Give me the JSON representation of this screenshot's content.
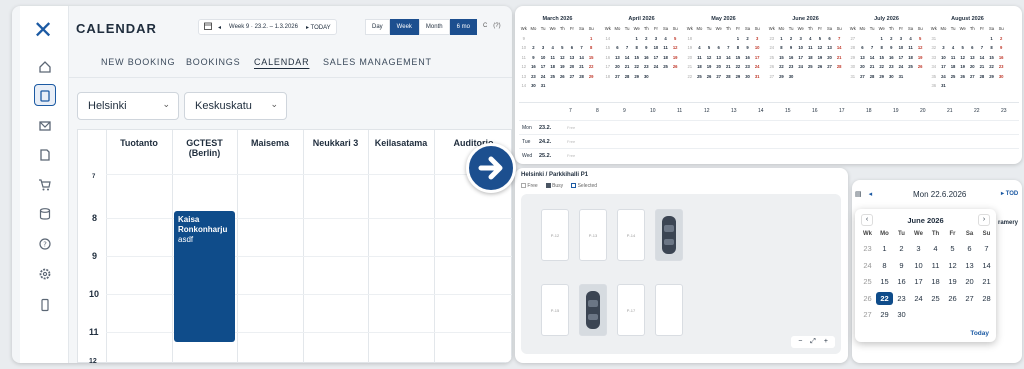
{
  "app": {
    "title": "CALENDAR",
    "date_range": "Week 9 · 23.2. – 1.3.2026",
    "today_label": "TODAY",
    "prev_label": "◂",
    "next_label": "▸",
    "help_label": "(?)",
    "refresh_label": "C",
    "views": [
      "Day",
      "Week",
      "Month",
      "6 mo"
    ],
    "tabs": [
      "NEW BOOKING",
      "BOOKINGS",
      "CALENDAR",
      "SALES MANAGEMENT"
    ],
    "city_select": "Helsinki",
    "street_select": "Keskuskatu",
    "columns": [
      "Tuotanto",
      "GCTEST\n(Berlin)",
      "Maisema",
      "Neukkari 3",
      "Keilasatama",
      "Auditorio"
    ],
    "hours": [
      "7",
      "8",
      "9",
      "10",
      "11",
      "12"
    ],
    "booking": {
      "name": "Kaisa Ronkonharju",
      "note": "asdf"
    },
    "colors": {
      "accent": "#0f4c8a",
      "brand": "#1c5aa3"
    },
    "sidebar_icons": [
      "home-icon",
      "document-icon",
      "mail-icon",
      "file-icon",
      "cart-icon",
      "database-icon",
      "help-icon",
      "settings-icon",
      "phone-icon"
    ]
  },
  "mini": {
    "months": [
      {
        "name": "March 2026",
        "weeks": [
          [
            "9",
            "",
            "",
            "",
            "",
            "",
            "",
            "1"
          ],
          [
            "10",
            "2",
            "3",
            "4",
            "5",
            "6",
            "7",
            "8"
          ],
          [
            "11",
            "9",
            "10",
            "11",
            "12",
            "13",
            "14",
            "15"
          ],
          [
            "12",
            "16",
            "17",
            "18",
            "19",
            "20",
            "21",
            "22"
          ],
          [
            "13",
            "23",
            "24",
            "25",
            "26",
            "27",
            "28",
            "29"
          ],
          [
            "14",
            "30",
            "31",
            "",
            "",
            "",
            "",
            ""
          ]
        ]
      },
      {
        "name": "April 2026",
        "weeks": [
          [
            "14",
            "",
            "",
            "1",
            "2",
            "3",
            "4",
            "5"
          ],
          [
            "15",
            "6",
            "7",
            "8",
            "9",
            "10",
            "11",
            "12"
          ],
          [
            "16",
            "13",
            "14",
            "15",
            "16",
            "17",
            "18",
            "19"
          ],
          [
            "17",
            "20",
            "21",
            "22",
            "23",
            "24",
            "25",
            "26"
          ],
          [
            "18",
            "27",
            "28",
            "29",
            "30",
            "",
            "",
            ""
          ]
        ]
      },
      {
        "name": "May 2026",
        "weeks": [
          [
            "18",
            "",
            "",
            "",
            "",
            "1",
            "2",
            "3"
          ],
          [
            "19",
            "4",
            "5",
            "6",
            "7",
            "8",
            "9",
            "10"
          ],
          [
            "20",
            "11",
            "12",
            "13",
            "14",
            "15",
            "16",
            "17"
          ],
          [
            "21",
            "18",
            "19",
            "20",
            "21",
            "22",
            "23",
            "24"
          ],
          [
            "22",
            "25",
            "26",
            "27",
            "28",
            "29",
            "30",
            "31"
          ]
        ]
      },
      {
        "name": "June 2026",
        "weeks": [
          [
            "23",
            "1",
            "2",
            "3",
            "4",
            "5",
            "6",
            "7"
          ],
          [
            "24",
            "8",
            "9",
            "10",
            "11",
            "12",
            "13",
            "14"
          ],
          [
            "25",
            "15",
            "16",
            "17",
            "18",
            "19",
            "20",
            "21"
          ],
          [
            "26",
            "22",
            "23",
            "24",
            "25",
            "26",
            "27",
            "28"
          ],
          [
            "27",
            "29",
            "30",
            "",
            "",
            "",
            "",
            ""
          ]
        ]
      },
      {
        "name": "July 2026",
        "weeks": [
          [
            "27",
            "",
            "",
            "1",
            "2",
            "3",
            "4",
            "5"
          ],
          [
            "28",
            "6",
            "7",
            "8",
            "9",
            "10",
            "11",
            "12"
          ],
          [
            "29",
            "13",
            "14",
            "15",
            "16",
            "17",
            "18",
            "19"
          ],
          [
            "30",
            "20",
            "21",
            "22",
            "23",
            "24",
            "25",
            "26"
          ],
          [
            "31",
            "27",
            "28",
            "29",
            "30",
            "31",
            "",
            ""
          ]
        ]
      },
      {
        "name": "August 2026",
        "weeks": [
          [
            "31",
            "",
            "",
            "",
            "",
            "",
            "1",
            "2"
          ],
          [
            "32",
            "3",
            "4",
            "5",
            "6",
            "7",
            "8",
            "9"
          ],
          [
            "33",
            "10",
            "11",
            "12",
            "13",
            "14",
            "15",
            "16"
          ],
          [
            "34",
            "17",
            "18",
            "19",
            "20",
            "21",
            "22",
            "23"
          ],
          [
            "35",
            "24",
            "25",
            "26",
            "27",
            "28",
            "29",
            "30"
          ],
          [
            "36",
            "31",
            "",
            "",
            "",
            "",
            "",
            ""
          ]
        ]
      }
    ],
    "weekday_header": [
      "Wk",
      "Mo",
      "Tu",
      "We",
      "Th",
      "Fr",
      "Sa",
      "Su"
    ],
    "timeline_hours": [
      "7",
      "8",
      "9",
      "10",
      "11",
      "12",
      "13",
      "14",
      "15",
      "16",
      "17",
      "18",
      "19",
      "20",
      "21",
      "22",
      "23"
    ],
    "timeline_rows": [
      {
        "day": "Mon",
        "date": "23.2.",
        "tag": "Free"
      },
      {
        "day": "Tue",
        "date": "24.2.",
        "tag": "Free"
      },
      {
        "day": "Wed",
        "date": "25.2.",
        "tag": "Free"
      }
    ]
  },
  "parking": {
    "title": "Helsinki / Parkkihalli P1",
    "legend": [
      "Free",
      "Busy",
      "Selected"
    ],
    "spots_top": [
      "P-12",
      "P-13",
      "P-14"
    ],
    "spots_bottom": [
      "P-15",
      "P-17"
    ],
    "zoom_controls": [
      "−",
      "⤢",
      "+"
    ]
  },
  "picker": {
    "header_date": "Mon 22.6.2026",
    "today_short": "TOD",
    "side_text": "ramery",
    "month": "June 2026",
    "days_header": [
      "Wk",
      "Mo",
      "Tu",
      "We",
      "Th",
      "Fr",
      "Sa",
      "Su"
    ],
    "weeks": [
      [
        "23",
        "1",
        "2",
        "3",
        "4",
        "5",
        "6",
        "7"
      ],
      [
        "24",
        "8",
        "9",
        "10",
        "11",
        "12",
        "13",
        "14"
      ],
      [
        "25",
        "15",
        "16",
        "17",
        "18",
        "19",
        "20",
        "21"
      ],
      [
        "26",
        "22",
        "23",
        "24",
        "25",
        "26",
        "27",
        "28"
      ],
      [
        "27",
        "29",
        "30",
        "",
        "",
        "",
        "",
        ""
      ]
    ],
    "selected": "22",
    "today_label": "Today"
  }
}
